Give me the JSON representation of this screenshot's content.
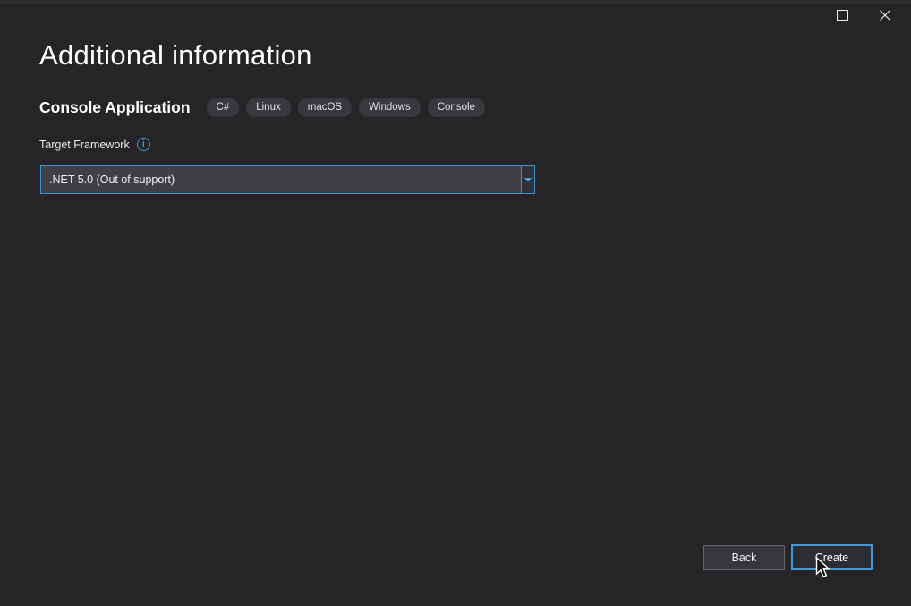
{
  "window": {
    "title_bar": {
      "maximize_tooltip": "Maximize",
      "close_tooltip": "Close"
    }
  },
  "header": {
    "title": "Additional information"
  },
  "project": {
    "name": "Console Application",
    "tags": [
      "C#",
      "Linux",
      "macOS",
      "Windows",
      "Console"
    ]
  },
  "form": {
    "target_framework": {
      "label": "Target Framework",
      "info_icon_glyph": "i",
      "selected_value": ".NET 5.0 (Out of support)"
    }
  },
  "footer": {
    "back_label": "Back",
    "create_label": "Create"
  },
  "colors": {
    "background": "#252527",
    "accent_blue": "#3E9BD6",
    "focused_border": "#3F9BDC",
    "dropdown_background": "#3F4046",
    "tag_background": "#39393D",
    "button_background": "#37373B",
    "text_primary": "#FFFFFF"
  }
}
